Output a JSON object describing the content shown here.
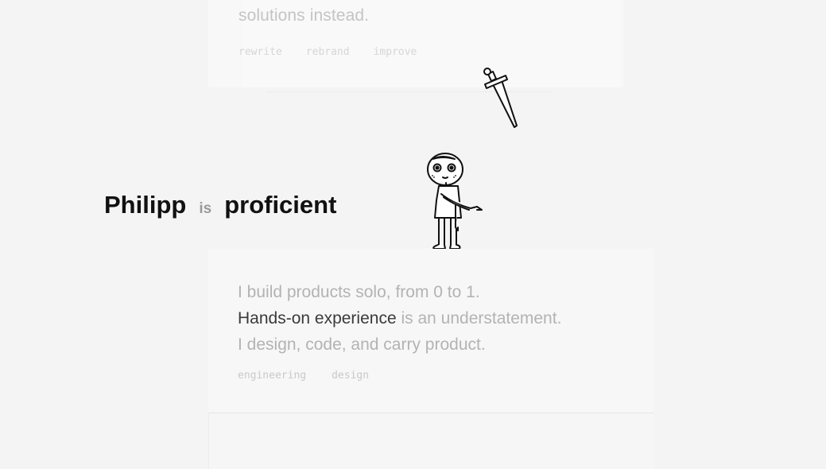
{
  "top_section": {
    "text": "solutions instead.",
    "tags": [
      "rewrite",
      "rebrand",
      "improve"
    ]
  },
  "headline": {
    "name": "Philipp",
    "verb": "is",
    "role": "proficient"
  },
  "card": {
    "line1": "I build products solo, from 0 to 1.",
    "line2_strong": "Hands-on experience",
    "line2_rest": " is an understatement.",
    "line3": "I design, code, and carry product.",
    "tags": [
      "engineering",
      "design"
    ]
  },
  "illustrations": {
    "character": "stick-figure-character",
    "weapon": "sword-icon"
  }
}
